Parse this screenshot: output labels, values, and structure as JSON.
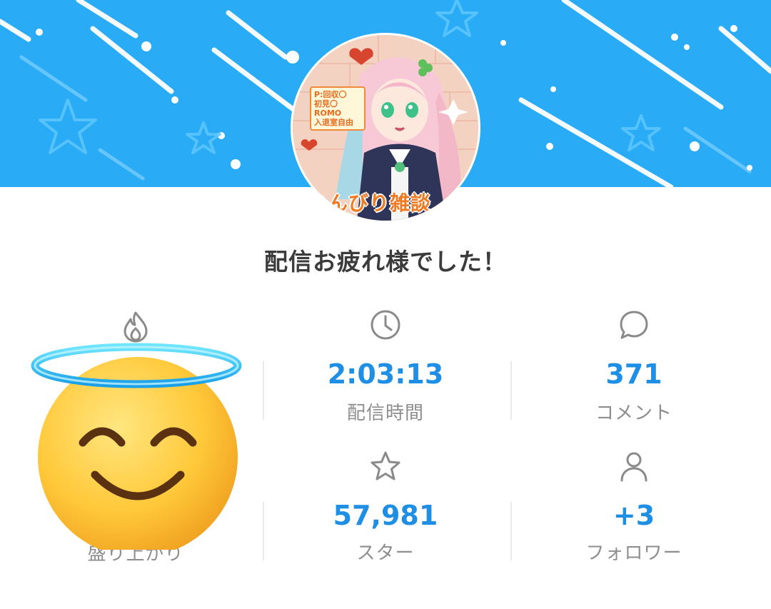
{
  "avatar": {
    "note_lines": [
      "P:回収〇",
      "初見〇",
      "ROMO",
      "入退室自由"
    ],
    "title": "のんびり雑談"
  },
  "headline": "配信お疲れ様でした！",
  "stats": [
    {
      "icon": "flame-icon",
      "value": "",
      "label": "盛り上がり"
    },
    {
      "icon": "clock-icon",
      "value": "2:03:13",
      "label": "配信時間"
    },
    {
      "icon": "speech-bubble-icon",
      "value": "371",
      "label": "コメント"
    },
    {
      "icon": "star-icon",
      "value": "57,981",
      "label": "スター"
    },
    {
      "icon": "person-icon",
      "value": "+3",
      "label": "フォロワー"
    }
  ],
  "colors": {
    "banner": "#29acf5",
    "accent": "#1f8fe6",
    "label": "#8e8e8e",
    "headline": "#3b3b3b"
  }
}
